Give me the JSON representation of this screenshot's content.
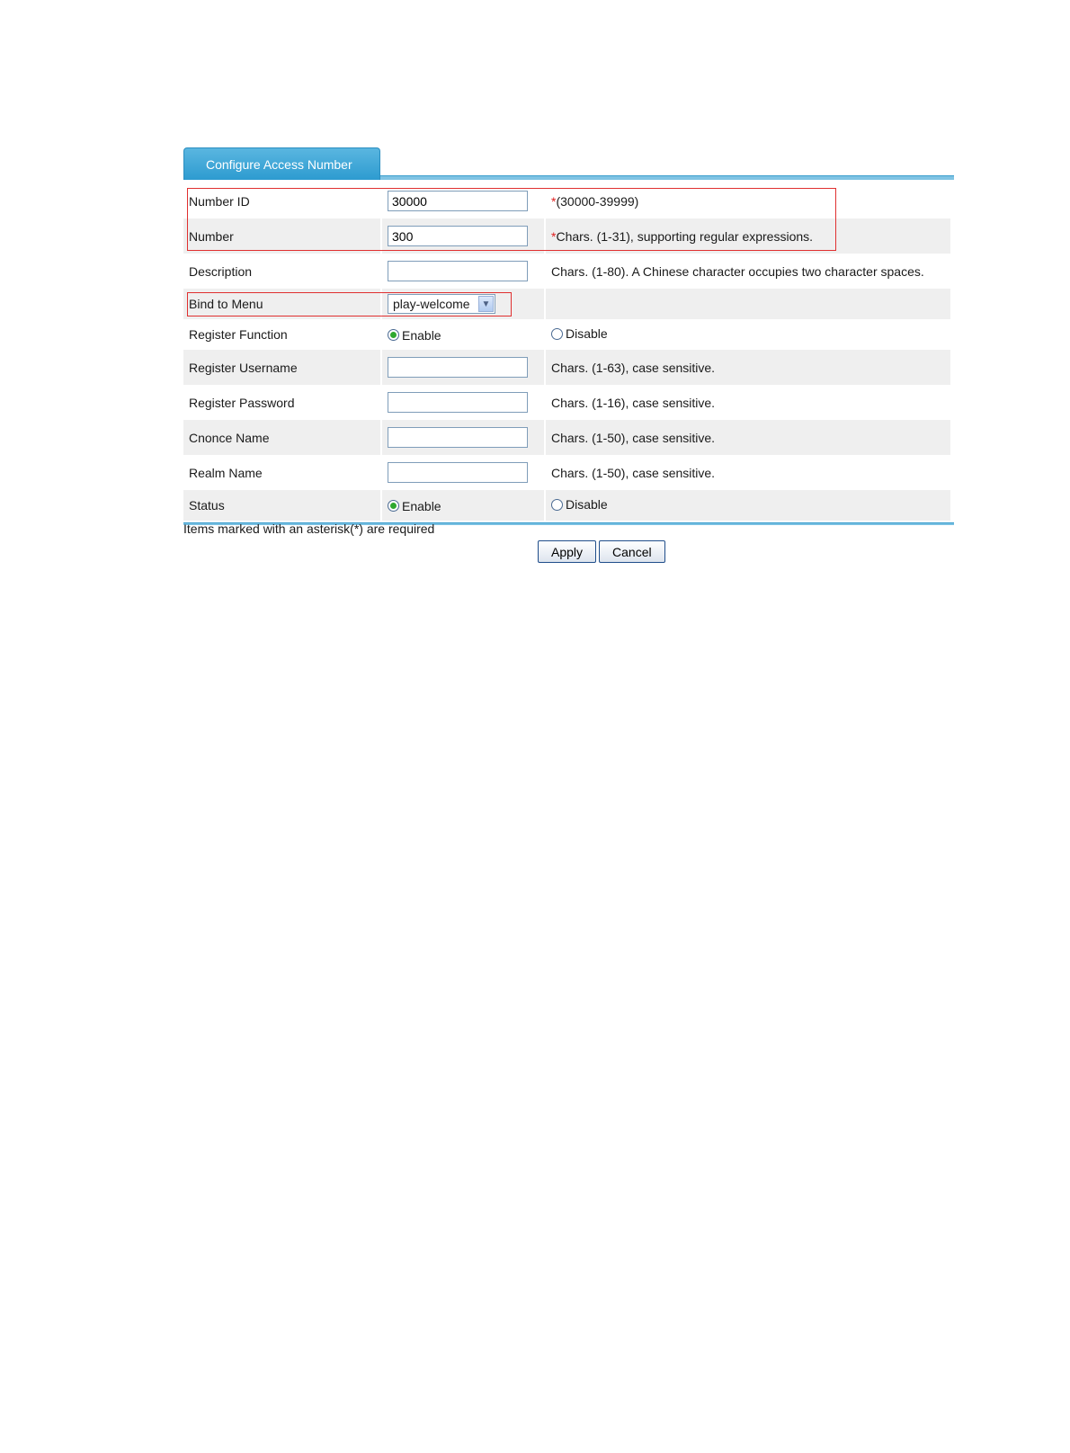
{
  "tab": {
    "title": "Configure Access Number"
  },
  "rows": {
    "number_id": {
      "label": "Number ID",
      "value": "30000",
      "asterisk": "*",
      "hint": "(30000-39999)"
    },
    "number": {
      "label": "Number",
      "value": "300",
      "asterisk": "*",
      "hint": "Chars. (1-31), supporting regular expressions."
    },
    "description": {
      "label": "Description",
      "value": "",
      "hint": "Chars. (1-80). A Chinese character occupies two character spaces."
    },
    "bind_to_menu": {
      "label": "Bind to Menu",
      "selected": "play-welcome"
    },
    "register_function": {
      "label": "Register Function",
      "options": [
        "Enable",
        "Disable"
      ],
      "selected": "Enable"
    },
    "register_username": {
      "label": "Register Username",
      "value": "",
      "hint": "Chars. (1-63), case sensitive."
    },
    "register_password": {
      "label": "Register Password",
      "value": "",
      "hint": "Chars. (1-16), case sensitive."
    },
    "cnonce_name": {
      "label": "Cnonce Name",
      "value": "",
      "hint": "Chars. (1-50), case sensitive."
    },
    "realm_name": {
      "label": "Realm Name",
      "value": "",
      "hint": "Chars. (1-50), case sensitive."
    },
    "status": {
      "label": "Status",
      "options": [
        "Enable",
        "Disable"
      ],
      "selected": "Enable"
    }
  },
  "footer": {
    "note": "Items marked with an asterisk(*) are required"
  },
  "buttons": {
    "apply": "Apply",
    "cancel": "Cancel"
  },
  "colors": {
    "tab": "#2d9bd0",
    "highlight": "#e03030",
    "radio_selected": "#2fa82f",
    "row_shade": "#efefef"
  }
}
